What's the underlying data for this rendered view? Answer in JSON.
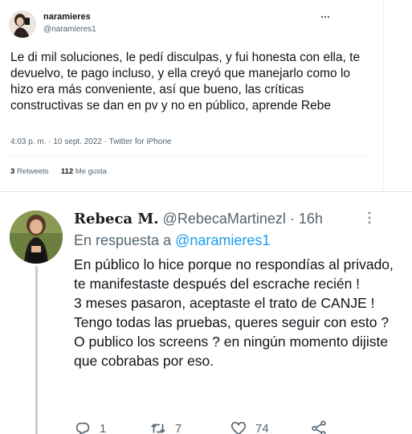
{
  "tweet1": {
    "author_name": "naramieres",
    "author_handle": "@naramieres1",
    "more_label": "···",
    "text": "Le di mil soluciones, le pedí disculpas, y fui honesta con ella, te devuelvo, te pago incluso, y ella creyó que manejarlo como lo hizo era más conveniente, así que bueno, las críticas constructivas se dan en pv y no en público, aprende Rebe",
    "timestamp": "4:03 p. m. · 10 sept. 2022 · Twitter for iPhone",
    "retweets_count": "3",
    "retweets_label": "Retweets",
    "likes_count": "112",
    "likes_label": "Me gusta"
  },
  "tweet2": {
    "author_name": "Rebeca M.",
    "author_handle": "@RebecaMartinezl",
    "time_ago": "· 16h",
    "reply_prefix": "En respuesta a",
    "reply_to": "@naramieres1",
    "text": "En público lo hice porque no respondías al privado, te manifestaste después del escrache recién !\n3 meses pasaron, aceptaste el trato de CANJE ! Tengo todas las pruebas, queres seguir con esto ? O publico los screens ? en ningún momento dijiste que cobrabas por eso.",
    "actions": {
      "reply_count": "1",
      "retweet_count": "7",
      "like_count": "74"
    }
  },
  "icons": [
    "more-icon",
    "reply-icon",
    "retweet-icon",
    "like-icon",
    "share-icon"
  ],
  "colors": {
    "link": "#1d9bf0",
    "secondary_text": "#536471",
    "thread_line": "#c4cfd6"
  }
}
